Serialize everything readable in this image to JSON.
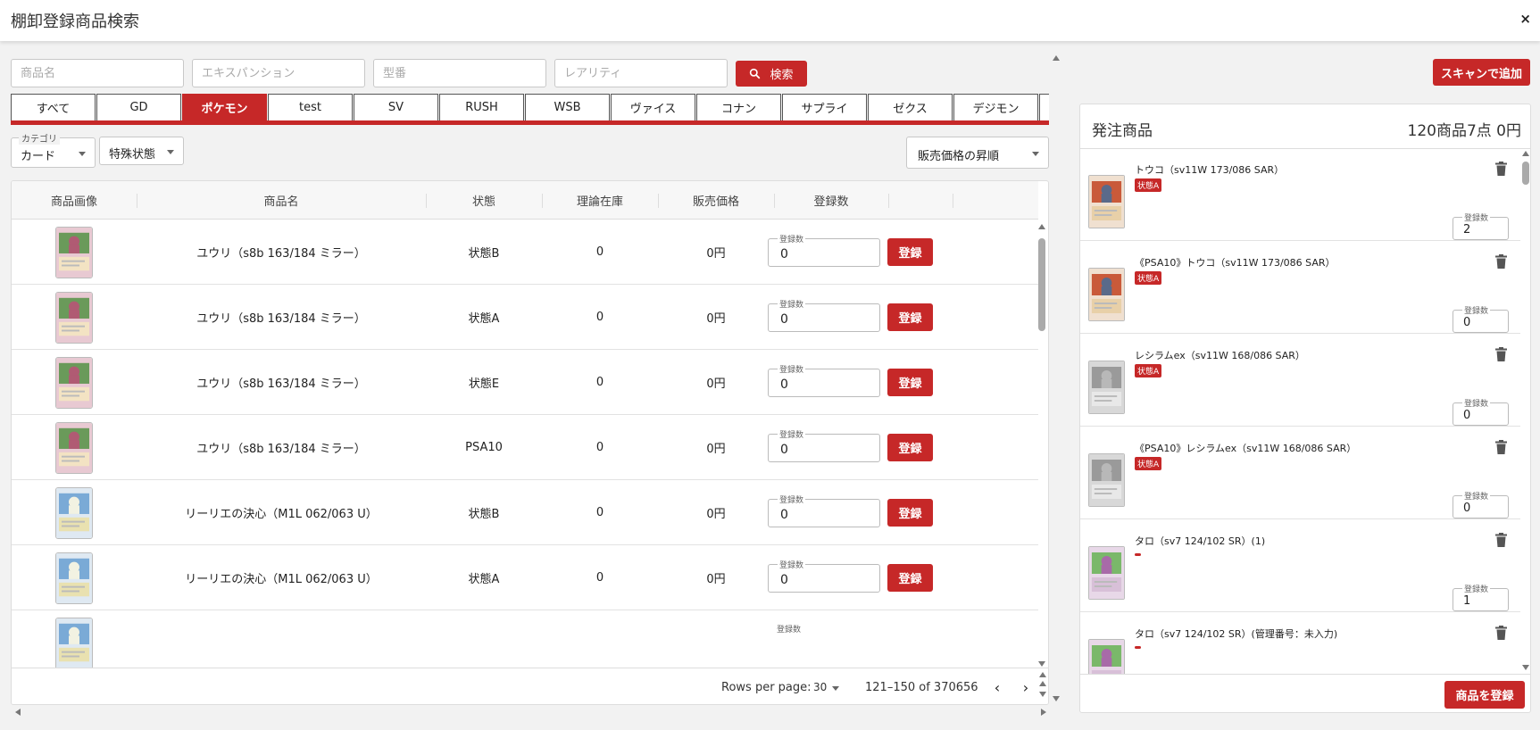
{
  "window": {
    "title": "棚卸登録商品検索",
    "close": "×"
  },
  "search": {
    "name_placeholder": "商品名",
    "expansion_placeholder": "エキスパンション",
    "model_placeholder": "型番",
    "rarity_placeholder": "レアリティ",
    "button_label": "検索"
  },
  "tabs": [
    {
      "label": "すべて"
    },
    {
      "label": "GD"
    },
    {
      "label": "ポケモン",
      "active": true
    },
    {
      "label": "test"
    },
    {
      "label": "SV"
    },
    {
      "label": "RUSH"
    },
    {
      "label": "WSB"
    },
    {
      "label": "ヴァイス"
    },
    {
      "label": "コナン"
    },
    {
      "label": "サプライ"
    },
    {
      "label": "ゼクス"
    },
    {
      "label": "デジモン"
    },
    {
      "label": ""
    }
  ],
  "filters": {
    "category_label": "カテゴリ",
    "category_value": "カード",
    "special_value": "特殊状態",
    "sort_value": "販売価格の昇順"
  },
  "table": {
    "headers": [
      "商品画像",
      "商品名",
      "状態",
      "理論在庫",
      "販売価格",
      "登録数"
    ],
    "qty_label": "登録数",
    "register_label": "登録",
    "rows": [
      {
        "name": "ユウリ（s8b 163/184 ミラー）",
        "condition": "状態B",
        "stock": "0",
        "price": "0円",
        "qty": "0",
        "art": "yuuri"
      },
      {
        "name": "ユウリ（s8b 163/184 ミラー）",
        "condition": "状態A",
        "stock": "0",
        "price": "0円",
        "qty": "0",
        "art": "yuuri"
      },
      {
        "name": "ユウリ（s8b 163/184 ミラー）",
        "condition": "状態E",
        "stock": "0",
        "price": "0円",
        "qty": "0",
        "art": "yuuri"
      },
      {
        "name": "ユウリ（s8b 163/184 ミラー）",
        "condition": "PSA10",
        "stock": "0",
        "price": "0円",
        "qty": "0",
        "art": "yuuri"
      },
      {
        "name": "リーリエの決心（M1L 062/063 U）",
        "condition": "状態B",
        "stock": "0",
        "price": "0円",
        "qty": "0",
        "art": "lillie"
      },
      {
        "name": "リーリエの決心（M1L 062/063 U）",
        "condition": "状態A",
        "stock": "0",
        "price": "0円",
        "qty": "0",
        "art": "lillie"
      },
      {
        "name": "",
        "condition": "",
        "stock": "",
        "price": "",
        "qty": "",
        "art": "lillie",
        "partial": true
      }
    ],
    "footer": {
      "rows_per_page_label": "Rows per page:",
      "rows_per_page_value": "30",
      "range": "121–150 of 370656"
    }
  },
  "order_panel": {
    "scan_button": "スキャンで追加",
    "title": "発注商品",
    "summary": "120商品7点 0円",
    "qty_label": "登録数",
    "submit_button": "商品を登録",
    "items": [
      {
        "name": "トウコ（sv11W 173/086 SAR）",
        "badge": "状態A",
        "qty": "2",
        "art": "touko"
      },
      {
        "name": "《PSA10》トウコ（sv11W 173/086 SAR）",
        "badge": "状態A",
        "qty": "0",
        "art": "touko"
      },
      {
        "name": "レシラムex（sv11W 168/086 SAR）",
        "badge": "状態A",
        "qty": "0",
        "art": "reshiram"
      },
      {
        "name": "《PSA10》レシラムex（sv11W 168/086 SAR）",
        "badge": "状態A",
        "qty": "0",
        "art": "reshiram"
      },
      {
        "name": "タロ（sv7 124/102 SR）(1)",
        "badge": "",
        "qty": "1",
        "art": "taro"
      },
      {
        "name": "タロ（sv7 124/102 SR）(管理番号：未入力)",
        "badge": "",
        "qty": "",
        "art": "taro"
      }
    ]
  },
  "colors": {
    "accent": "#c62828",
    "background": "#f2f2f2"
  },
  "icons": {
    "search": "search-icon",
    "trash": "trash-icon",
    "prev": "chevron-left-icon",
    "next": "chevron-right-icon"
  }
}
